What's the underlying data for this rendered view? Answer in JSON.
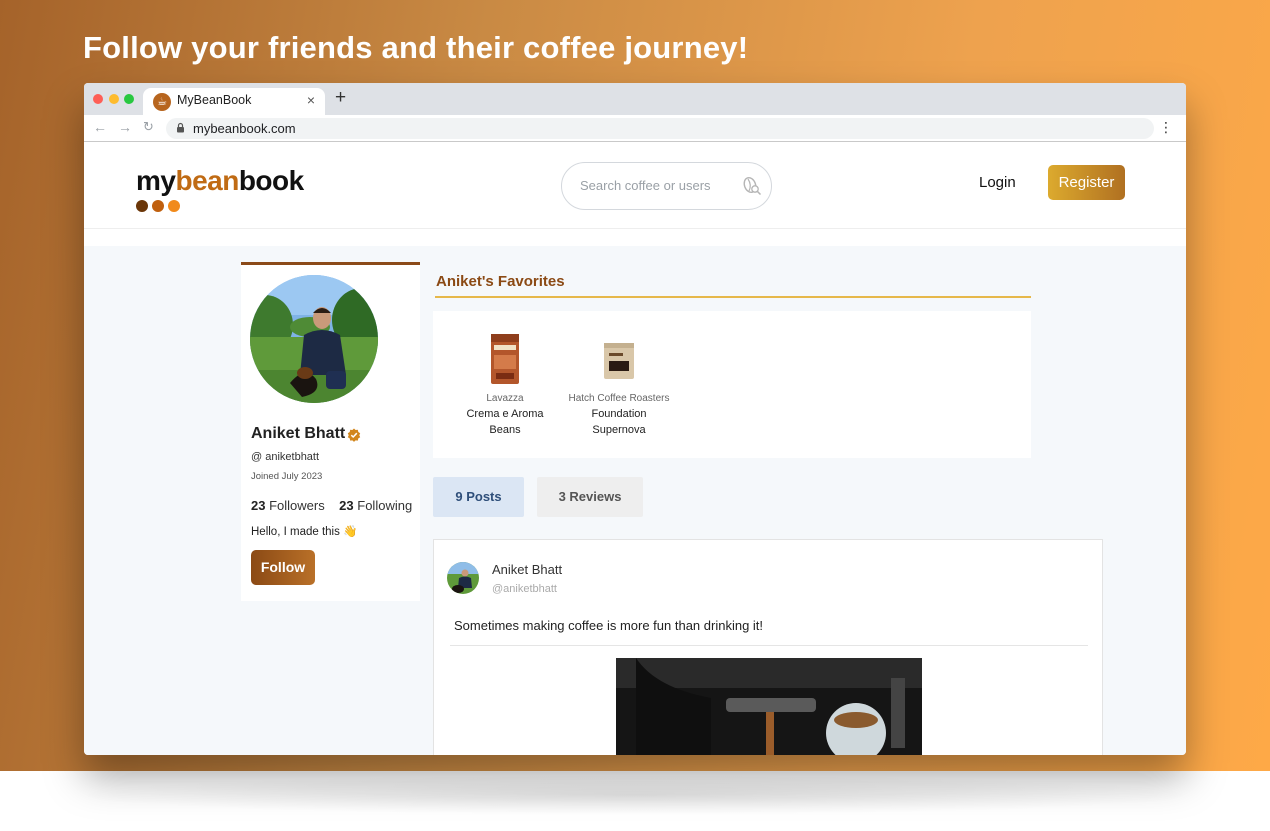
{
  "hero": {
    "title": "Follow your friends and their coffee journey!"
  },
  "browser": {
    "tab_title": "MyBeanBook",
    "close_glyph": "×",
    "new_tab_glyph": "+",
    "url": "mybeanbook.com"
  },
  "header": {
    "logo": {
      "part1": "my",
      "part2": "bean",
      "part3": "book"
    },
    "search": {
      "placeholder": "Search coffee or users"
    },
    "login_label": "Login",
    "register_label": "Register"
  },
  "profile": {
    "name": "Aniket Bhatt",
    "handle": "@ aniketbhatt",
    "joined": "Joined July 2023",
    "followers_count": "23",
    "followers_label": "Followers",
    "following_count": "23",
    "following_label": "Following",
    "bio": "Hello, I made this 👋",
    "follow_label": "Follow"
  },
  "favorites": {
    "title": "Aniket's Favorites",
    "items": [
      {
        "brand": "Lavazza",
        "name_line1": "Crema e Aroma",
        "name_line2": "Beans"
      },
      {
        "brand": "Hatch Coffee Roasters",
        "name_line1": "Foundation",
        "name_line2": "Supernova"
      }
    ]
  },
  "tabs": {
    "posts": "9 Posts",
    "reviews": "3 Reviews"
  },
  "post": {
    "author": "Aniket Bhatt",
    "handle": "@aniketbhatt",
    "text": "Sometimes making coffee is more fun than drinking it!"
  },
  "colors": {
    "brand_brown": "#8b4a15",
    "accent_orange": "#c06b14",
    "gold": "#dcaa2e"
  }
}
